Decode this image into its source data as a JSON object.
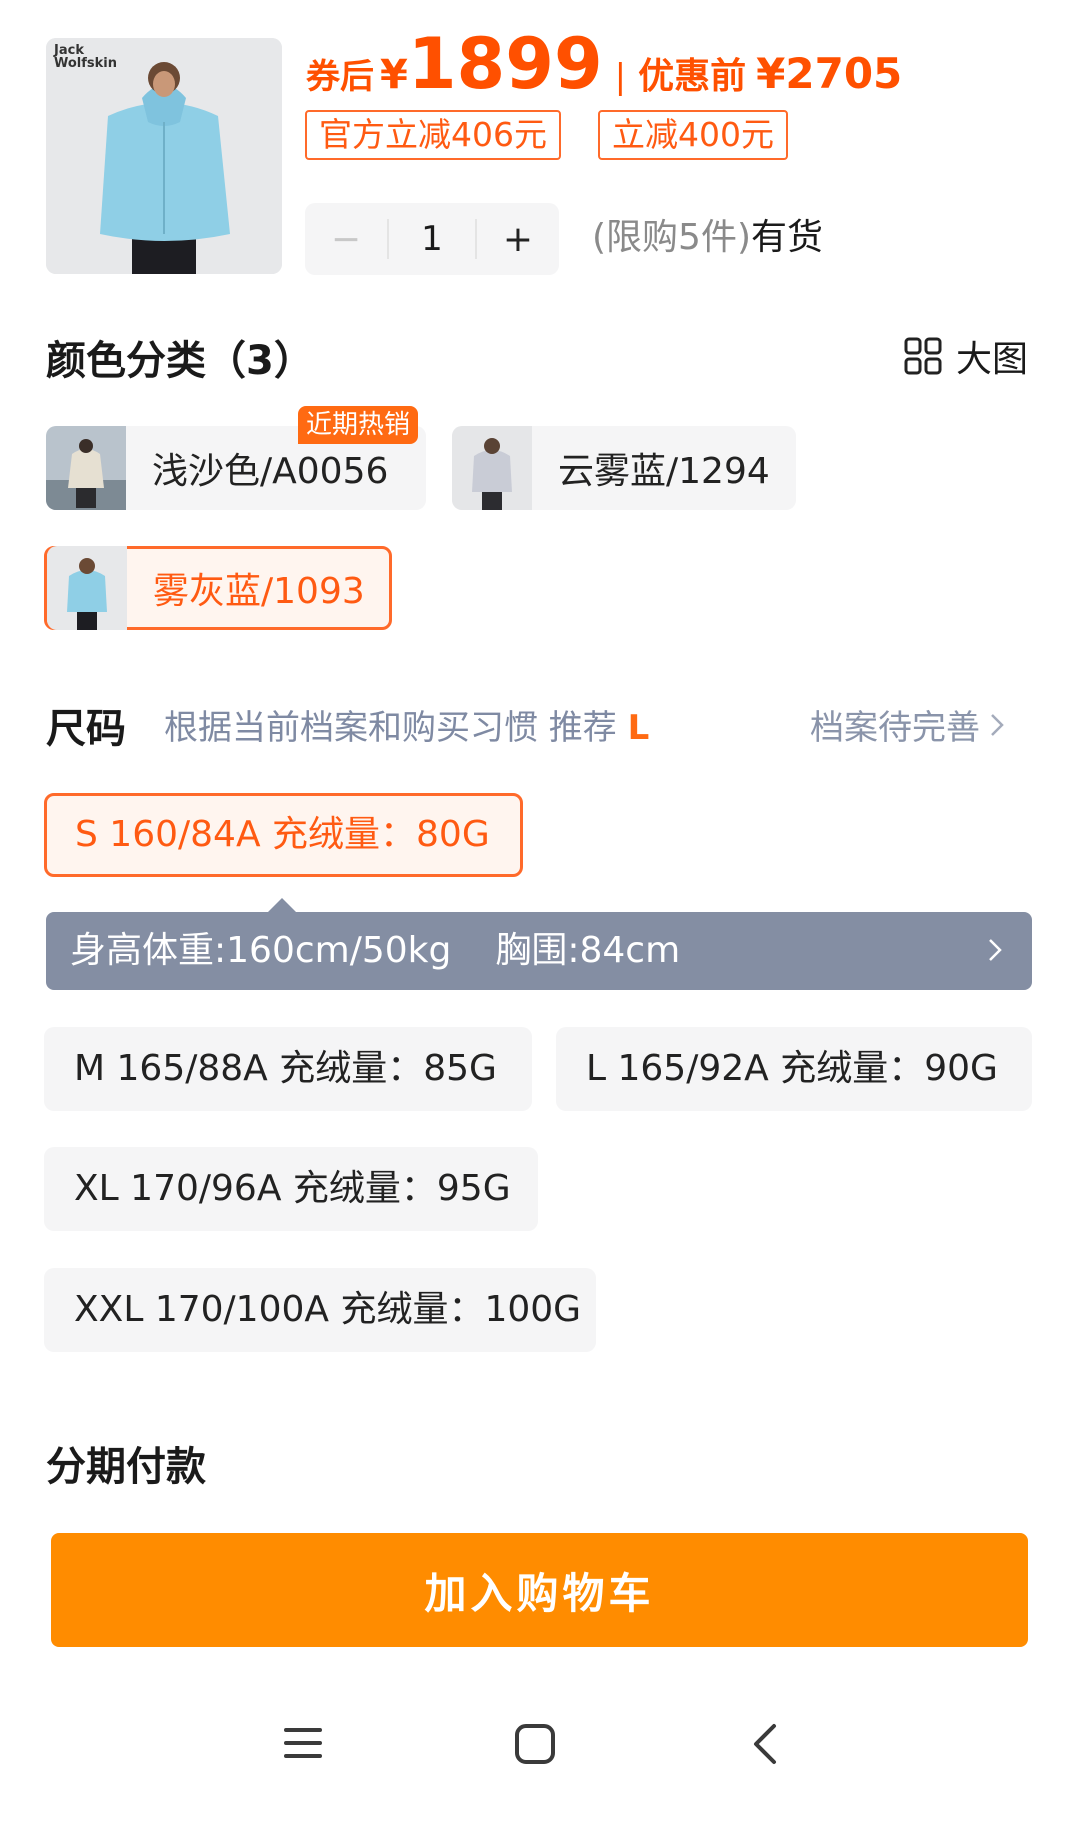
{
  "product": {
    "price_label": "券后",
    "currency": "¥",
    "price": "1899",
    "separator": "|",
    "before_label": "优惠前",
    "before_price": "¥2705",
    "promos": [
      "官方立减406元",
      "立减400元"
    ],
    "brand_logo_text": "Jack Wolfskin"
  },
  "quantity": {
    "minus": "−",
    "value": "1",
    "plus": "+",
    "limit_text": "(限购5件)",
    "stock_text": "有货"
  },
  "color_section": {
    "title": "颜色分类（3）",
    "big_image_label": "大图",
    "hot_badge": "近期热销",
    "options": [
      {
        "label": "浅沙色/A0056",
        "selected": false
      },
      {
        "label": "云雾蓝/1294",
        "selected": false
      },
      {
        "label": "雾灰蓝/1093",
        "selected": true
      }
    ]
  },
  "size_section": {
    "title": "尺码",
    "hint_prefix": "根据当前档案和购买习惯 推荐",
    "recommended": "L",
    "profile_link": "档案待完善",
    "options": [
      {
        "label": "S 160/84A 充绒量：80G",
        "selected": true
      },
      {
        "label": "M 165/88A 充绒量：85G",
        "selected": false
      },
      {
        "label": "L 165/92A 充绒量：90G",
        "selected": false
      },
      {
        "label": "XL 170/96A 充绒量：95G",
        "selected": false
      },
      {
        "label": "XXL 170/100A 充绒量：100G",
        "selected": false
      }
    ],
    "tip_height_weight": "身高体重:160cm/50kg",
    "tip_chest": "胸围:84cm"
  },
  "installment_title": "分期付款",
  "cart_button": "加入购物车",
  "colors": {
    "accent": "#ff5000",
    "selected_border": "#ff6a2a",
    "cart_button": "#ff8c00",
    "tip_bg": "#848ea3"
  },
  "icons": [
    "grid-icon",
    "chevron-right-icon",
    "menu-icon",
    "home-icon",
    "back-icon"
  ]
}
